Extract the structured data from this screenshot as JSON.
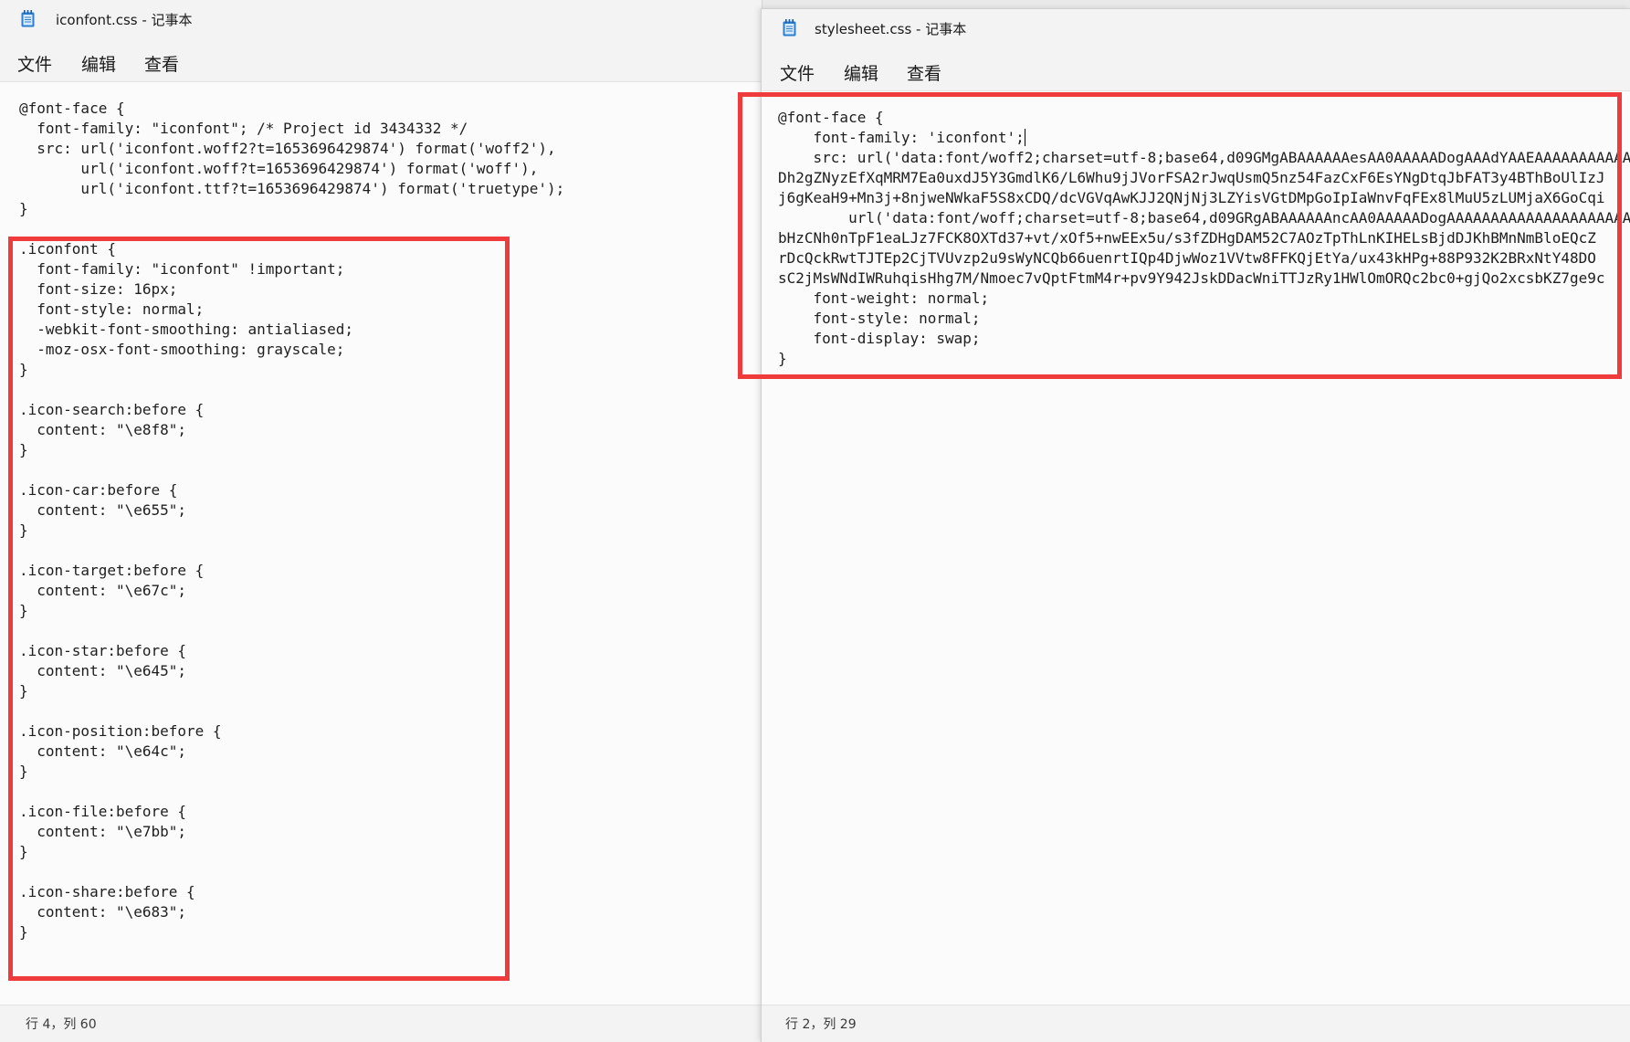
{
  "colors": {
    "highlight": "#ef3b3b",
    "app_icon": "#2b7fd1"
  },
  "left_window": {
    "icon": "notepad-icon",
    "title": "iconfont.css - 记事本",
    "menu": [
      "文件",
      "编辑",
      "查看"
    ],
    "code": "@font-face {\n  font-family: \"iconfont\"; /* Project id 3434332 */\n  src: url('iconfont.woff2?t=1653696429874') format('woff2'),\n       url('iconfont.woff?t=1653696429874') format('woff'),\n       url('iconfont.ttf?t=1653696429874') format('truetype');\n}\n\n.iconfont {\n  font-family: \"iconfont\" !important;\n  font-size: 16px;\n  font-style: normal;\n  -webkit-font-smoothing: antialiased;\n  -moz-osx-font-smoothing: grayscale;\n}\n\n.icon-search:before {\n  content: \"\\e8f8\";\n}\n\n.icon-car:before {\n  content: \"\\e655\";\n}\n\n.icon-target:before {\n  content: \"\\e67c\";\n}\n\n.icon-star:before {\n  content: \"\\e645\";\n}\n\n.icon-position:before {\n  content: \"\\e64c\";\n}\n\n.icon-file:before {\n  content: \"\\e7bb\";\n}\n\n.icon-share:before {\n  content: \"\\e683\";\n}",
    "status": "行 4，列 60"
  },
  "right_window": {
    "icon": "notepad-icon",
    "title": "stylesheet.css - 记事本",
    "menu": [
      "文件",
      "编辑",
      "查看"
    ],
    "code_before_caret": "@font-face {\n    font-family: 'iconfont';",
    "code_after_caret": "\n    src: url('data:font/woff2;charset=utf-8;base64,d09GMgABAAAAAAesAA0AAAAADogAAAdYAAEAAAAAAAAAAAAAAAAAAAAAAAAAAAAA\nDh2gZNyzEfXqMRM7Ea0uxdJ5Y3GmdlK6/L6Whu9jJVorFSA2rJwqUsmQ5nz54FazCxF6EsYNgDtqJbFAT3y4BThBoUlIzJ\nj6gKeaH9+Mn3j+8njweNWkaF5S8xCDQ/dcVGVqAwKJJ2QNjNj3LZYisVGtDMpGoIpIaWnvFqFEx8lMuU5zLUMjaX6GoCqi\n        url('data:font/woff;charset=utf-8;base64,d09GRgABAAAAAAncAA0AAAAADogAAAAAAAAAAAAAAAAAAAAAAAAAAAAAAAAAAAAAA\nbHzCNh0nTpF1eaLJz7FCK8OXTd37+vt/xOf5+nwEEx5u/s3fZDHgDAM52C7AOzTpThLnKIHELsBjdDJKhBMnNmBloEQcZ\nrDcQckRwtTJTEp2CjTVUvzp2u9sWyNCQb66uenrtIQp4DjwWoz1VVtw8FFKQjEtYa/ux43kHPg+88P932K2BRxNtY48DO\nsC2jMsWNdIWRuhqisHhg7M/Nmoec7vQptFtmM4r+pv9Y942JskDDacWniTTJzRy1HWlOmORQc2bc0+gjQo2xcsbKZ7ge9c\n    font-weight: normal;\n    font-style: normal;\n    font-display: swap;\n}",
    "status": "行 2，列 29"
  }
}
